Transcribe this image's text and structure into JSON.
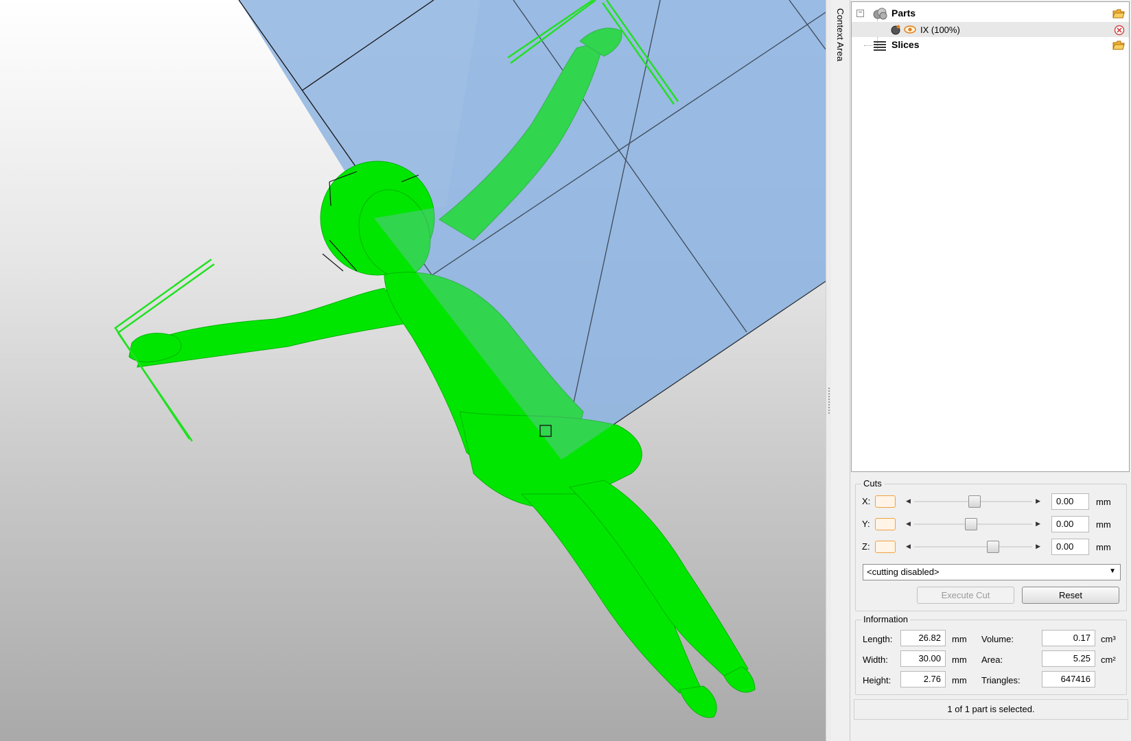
{
  "context_tab": {
    "label": "Context Area"
  },
  "tree": {
    "items": [
      {
        "label": "Parts",
        "icon": "parts-icon"
      },
      {
        "label": "IX (100%)",
        "icon": "part-object-icon"
      },
      {
        "label": "Slices",
        "icon": "slices-icon"
      }
    ]
  },
  "cuts": {
    "title": "Cuts",
    "axes": [
      {
        "label": "X:",
        "value": "0.00",
        "unit": "mm",
        "slider_fraction": 0.51
      },
      {
        "label": "Y:",
        "value": "0.00",
        "unit": "mm",
        "slider_fraction": 0.48
      },
      {
        "label": "Z:",
        "value": "0.00",
        "unit": "mm",
        "slider_fraction": 0.69
      }
    ],
    "mode": "<cutting disabled>",
    "execute_label": "Execute Cut",
    "reset_label": "Reset"
  },
  "information": {
    "title": "Information",
    "length_label": "Length:",
    "length_value": "26.82",
    "length_unit": "mm",
    "width_label": "Width:",
    "width_value": "30.00",
    "width_unit": "mm",
    "height_label": "Height:",
    "height_value": "2.76",
    "height_unit": "mm",
    "volume_label": "Volume:",
    "volume_value": "0.17",
    "volume_unit": "cm³",
    "area_label": "Area:",
    "area_value": "5.25",
    "area_unit": "cm²",
    "triangles_label": "Triangles:",
    "triangles_value": "647416"
  },
  "status": "1 of 1 part is selected.",
  "colors": {
    "model": "#00e600",
    "plane": "#8fb4e0",
    "accent": "#f0a040"
  }
}
